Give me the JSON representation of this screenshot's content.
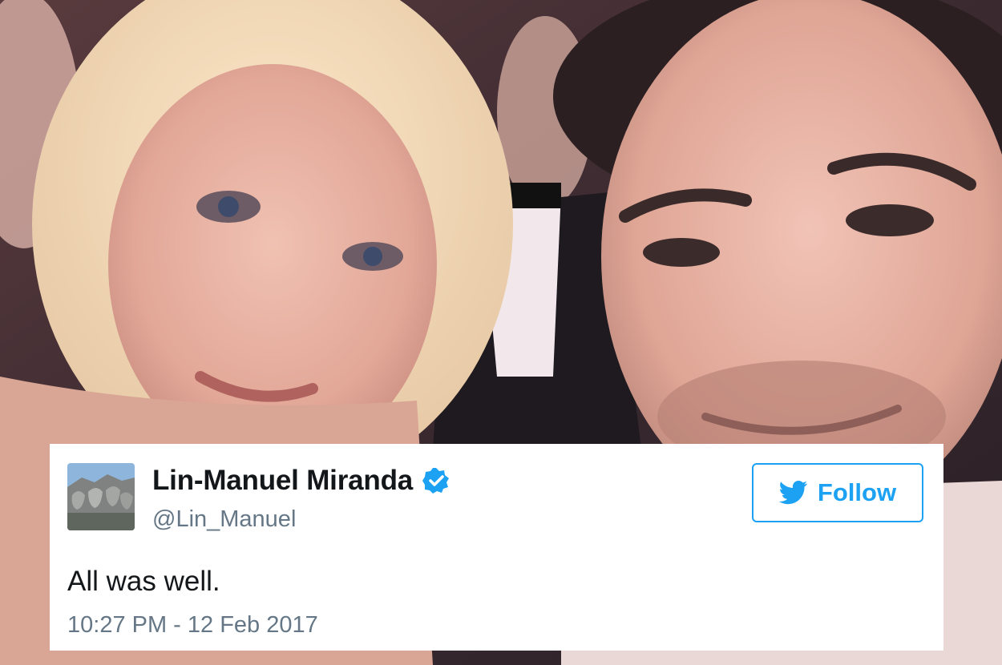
{
  "tweet": {
    "display_name": "Lin-Manuel Miranda",
    "handle": "@Lin_Manuel",
    "verified_icon": "verified-badge-icon",
    "avatar_icon": "mount-rushmore-avatar",
    "follow_label": "Follow",
    "follow_icon": "twitter-bird-icon",
    "text": "All was well.",
    "timestamp": "10:27 PM - 12 Feb 2017"
  },
  "colors": {
    "twitter_blue": "#1da1f2",
    "name_text": "#14171a",
    "secondary_text": "#657786",
    "card_background": "#ffffff"
  }
}
